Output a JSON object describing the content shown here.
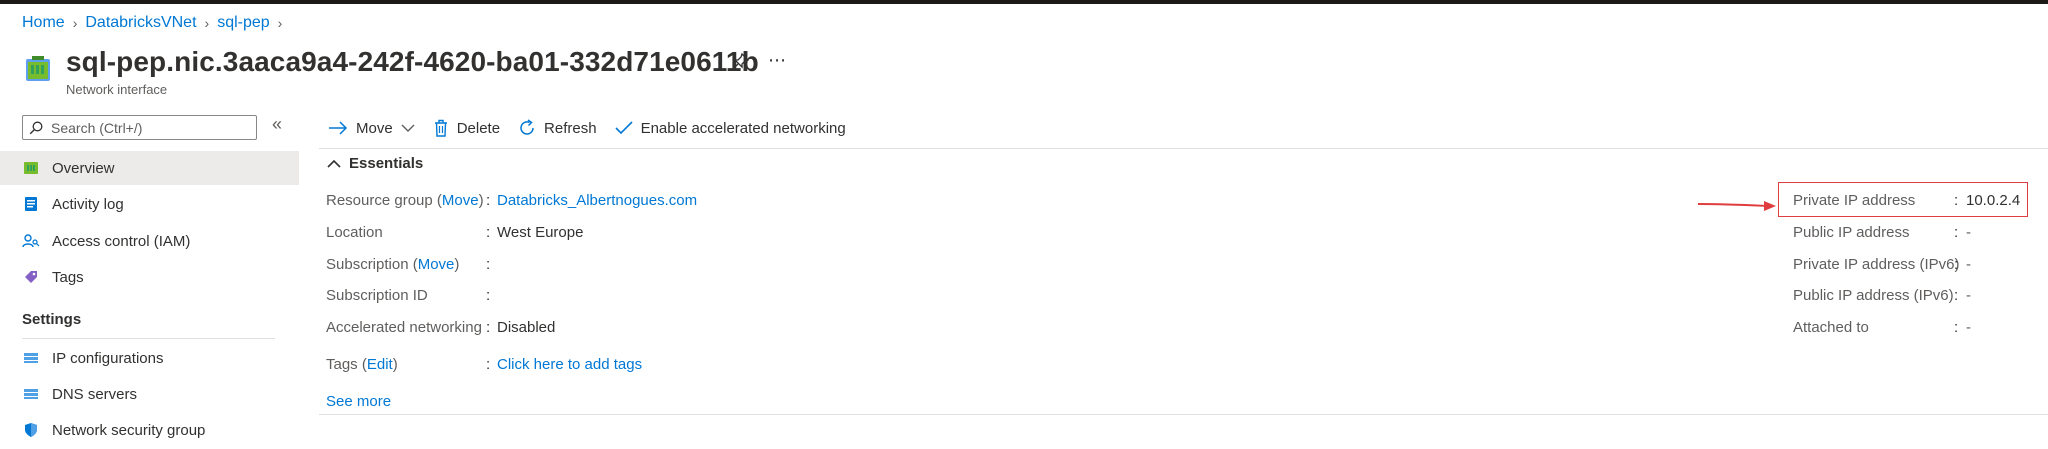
{
  "breadcrumb": [
    "Home",
    "DatabricksVNet",
    "sql-pep"
  ],
  "title": "sql-pep.nic.3aaca9a4-242f-4620-ba01-332d71e0611b",
  "subtitle": "Network interface",
  "search": {
    "placeholder": "Search (Ctrl+/)"
  },
  "sidebar": {
    "items": [
      {
        "label": "Overview",
        "icon": "overview-icon"
      },
      {
        "label": "Activity log",
        "icon": "activity-log-icon"
      },
      {
        "label": "Access control (IAM)",
        "icon": "iam-icon"
      },
      {
        "label": "Tags",
        "icon": "tag-icon"
      }
    ],
    "settings_label": "Settings",
    "settings_items": [
      {
        "label": "IP configurations",
        "icon": "ip-config-icon"
      },
      {
        "label": "DNS servers",
        "icon": "dns-icon"
      },
      {
        "label": "Network security group",
        "icon": "shield-icon"
      }
    ]
  },
  "toolbar": {
    "move": "Move",
    "delete": "Delete",
    "refresh": "Refresh",
    "enable": "Enable accelerated networking"
  },
  "essentials": {
    "heading": "Essentials",
    "left": {
      "rg_label": "Resource group",
      "rg_move": "Move",
      "rg_value": "Databricks_Albertnogues.com",
      "loc_label": "Location",
      "loc_value": "West Europe",
      "sub_label": "Subscription",
      "sub_move": "Move",
      "subid_label": "Subscription ID",
      "accel_label": "Accelerated networking",
      "accel_value": "Disabled",
      "tags_label": "Tags",
      "tags_edit": "Edit",
      "tags_value": "Click here to add tags"
    },
    "right": [
      {
        "label": "Private IP address",
        "value": "10.0.2.4"
      },
      {
        "label": "Public IP address",
        "value": "-"
      },
      {
        "label": "Private IP address (IPv6)",
        "value": "-"
      },
      {
        "label": "Public IP address (IPv6)",
        "value": "-"
      },
      {
        "label": "Attached to",
        "value": "-"
      }
    ],
    "see_more": "See more"
  },
  "colors": {
    "link": "#0078d4",
    "highlight": "#e03e3e",
    "active_nav": "#edebe9"
  }
}
